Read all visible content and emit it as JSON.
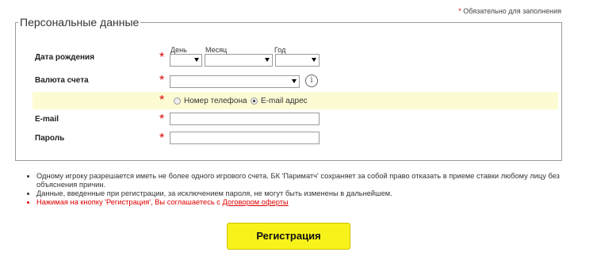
{
  "required_note": {
    "star": "*",
    "text": "Обязательно для заполнения"
  },
  "section": {
    "title": "Персональные данные"
  },
  "birth_date": {
    "label": "Дата рождения",
    "day_caption": "День",
    "month_caption": "Месяц",
    "year_caption": "Год",
    "day_value": "",
    "month_value": "",
    "year_value": ""
  },
  "currency": {
    "label": "Валюта счета",
    "value": "",
    "info_glyph": "i"
  },
  "contact_method": {
    "options": [
      {
        "label": "Номер телефона",
        "checked": false
      },
      {
        "label": "E-mail адрес",
        "checked": true
      }
    ]
  },
  "email": {
    "label": "E-mail",
    "value": ""
  },
  "password": {
    "label": "Пароль",
    "value": ""
  },
  "required_star": "*",
  "notes": {
    "line1": "Одному игроку разрешается иметь не более одного игрового счета. БК 'Париматч' сохраняет за собой право отказать в приеме ставки любому лицу без объяснения причин.",
    "line2": "Данные, введенные при регистрации, за исключением пароля, не могут быть изменены в дальнейшем.",
    "line3_text": "Нажимая на кнопку 'Регистрация', Вы соглашаетесь с ",
    "line3_link": "Договором оферты"
  },
  "register_button": "Регистрация",
  "colors": {
    "accent_red": "#e00000",
    "button_yellow": "#f7f21a",
    "highlight_row": "#fdfbd4"
  }
}
